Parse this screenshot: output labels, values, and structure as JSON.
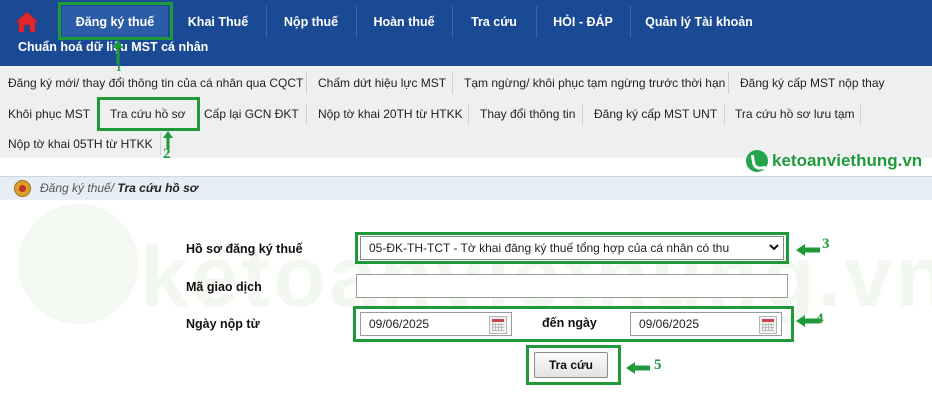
{
  "nav": {
    "home_icon": "home-icon",
    "items": [
      "Đăng ký thuế",
      "Khai Thuế",
      "Nộp thuế",
      "Hoàn thuế",
      "Tra cứu",
      "HỎI - ĐÁP",
      "Quản lý Tài khoản"
    ],
    "row2": "Chuẩn hoá dữ liệu MST cá nhân",
    "active_index": 0
  },
  "submenu": {
    "items": [
      "Đăng ký mới/ thay đổi thông tin của cá nhân qua CQCT",
      "Chấm dứt hiệu lực MST",
      "Tạm ngừng/ khôi phục tạm ngừng trước thời hạn",
      "Đăng ký cấp MST nộp thay",
      "Khôi phục MST",
      "Tra cứu hồ sơ",
      "Cấp lại GCN ĐKT",
      "Nộp tờ khai 20TH từ HTKK",
      "Thay đổi thông tin",
      "Đăng ký cấp MST UNT",
      "Tra cứu hồ sơ lưu tạm",
      "Nộp tờ khai 05TH từ HTKK"
    ]
  },
  "breadcrumb": {
    "parent": "Đăng ký thuế/",
    "current": " Tra cứu hồ sơ"
  },
  "form": {
    "label_hoso": "Hồ sơ đăng ký thuế",
    "hoso_value": "05-ĐK-TH-TCT - Tờ khai đăng ký thuế tổng hợp của cá nhân có thu",
    "label_magd": "Mã giao dịch",
    "magd_value": "",
    "label_from": "Ngày nộp từ",
    "from_value": "09/06/2025",
    "label_to": "đến ngày",
    "to_value": "09/06/2025",
    "search_label": "Tra cứu"
  },
  "annotations": {
    "steps": [
      "1",
      "2",
      "3",
      "4",
      "5"
    ],
    "color": "#1f9a3a"
  },
  "watermark": {
    "logo_text": "ketoanviethung.vn",
    "bg_text": "ketoanviethung.vn"
  },
  "colors": {
    "nav_bg": "#1a4a93",
    "submenu_bg": "#efefef",
    "breadcrumb_bg": "#e6edf5"
  }
}
